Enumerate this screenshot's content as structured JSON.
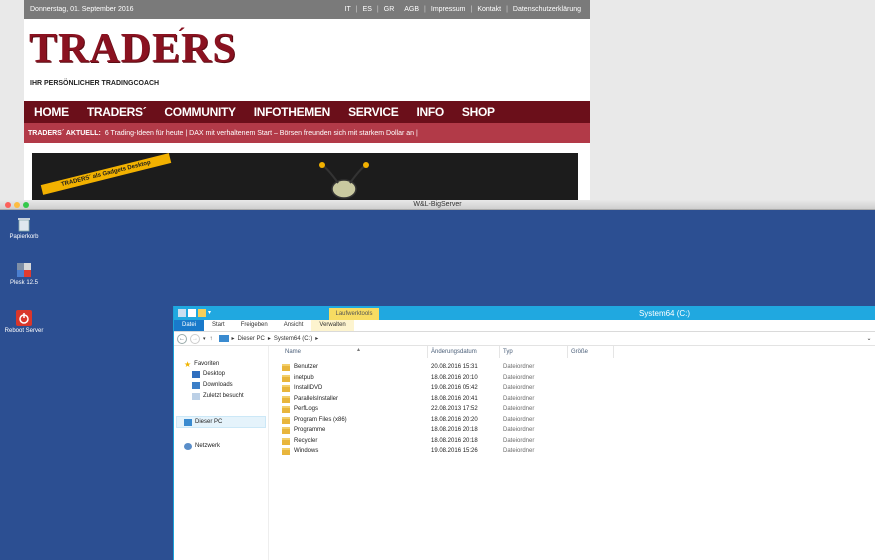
{
  "web": {
    "date": "Donnerstag, 01. September 2016",
    "top_links": [
      "IT",
      "ES",
      "GR",
      "AGB",
      "Impressum",
      "Kontakt",
      "Datenschutzerklärung"
    ],
    "logo": "TRADERS",
    "logo_mark": "´",
    "tagline": "IHR PERSÖNLICHER TRADINGCOACH",
    "nav": [
      "HOME",
      "TRADERS´",
      "COMMUNITY",
      "INFOTHEMEN",
      "SERVICE",
      "INFO",
      "SHOP"
    ],
    "ticker_label": "TRADERS´ AKTUELL:",
    "ticker_text": "6 Trading-Ideen für heute  |  DAX mit verhaltenem Start – Börsen freunden sich mit starkem Dollar an  |",
    "banner_ribbon": "TRADERS´ als Gadgets Desktop"
  },
  "rdp": {
    "title": "W&L-BigServer"
  },
  "desktop_icons": [
    {
      "label": "Papierkorb",
      "icon": "recycle-bin-icon"
    },
    {
      "label": "Plesk 12.5",
      "icon": "plesk-icon"
    },
    {
      "label": "Reboot Server",
      "icon": "reboot-icon"
    }
  ],
  "explorer": {
    "title": "System64 (C:)",
    "context_tab": "Laufwerktools",
    "tabs": [
      "Datei",
      "Start",
      "Freigeben",
      "Ansicht",
      "Verwalten"
    ],
    "address": {
      "parts": [
        "Dieser PC",
        "System64 (C:)"
      ],
      "sep": "▸"
    },
    "nav_pane": {
      "favorites": "Favoriten",
      "favorite_items": [
        "Desktop",
        "Downloads",
        "Zuletzt besucht"
      ],
      "this_pc": "Dieser PC",
      "network": "Netzwerk"
    },
    "columns": [
      "Name",
      "Änderungsdatum",
      "Typ",
      "Größe"
    ],
    "files": [
      {
        "name": "Benutzer",
        "date": "20.08.2016 15:31",
        "type": "Dateiordner"
      },
      {
        "name": "inetpub",
        "date": "18.08.2016 20:10",
        "type": "Dateiordner"
      },
      {
        "name": "InstallDVD",
        "date": "19.08.2016 05:42",
        "type": "Dateiordner"
      },
      {
        "name": "ParallelsInstaller",
        "date": "18.08.2016 20:41",
        "type": "Dateiordner"
      },
      {
        "name": "PerfLogs",
        "date": "22.08.2013 17:52",
        "type": "Dateiordner"
      },
      {
        "name": "Program Files (x86)",
        "date": "18.08.2016 20:20",
        "type": "Dateiordner"
      },
      {
        "name": "Programme",
        "date": "18.08.2016 20:18",
        "type": "Dateiordner"
      },
      {
        "name": "Recycler",
        "date": "18.08.2016 20:18",
        "type": "Dateiordner"
      },
      {
        "name": "Windows",
        "date": "19.08.2016 15:26",
        "type": "Dateiordner"
      }
    ]
  },
  "colors": {
    "brand_red": "#8a1220",
    "nav_red": "#6b0f1a",
    "ticker_red": "#b23a48",
    "desktop_blue": "#2c4f92",
    "explorer_title": "#20a8e0",
    "file_tab": "#1979ca"
  }
}
